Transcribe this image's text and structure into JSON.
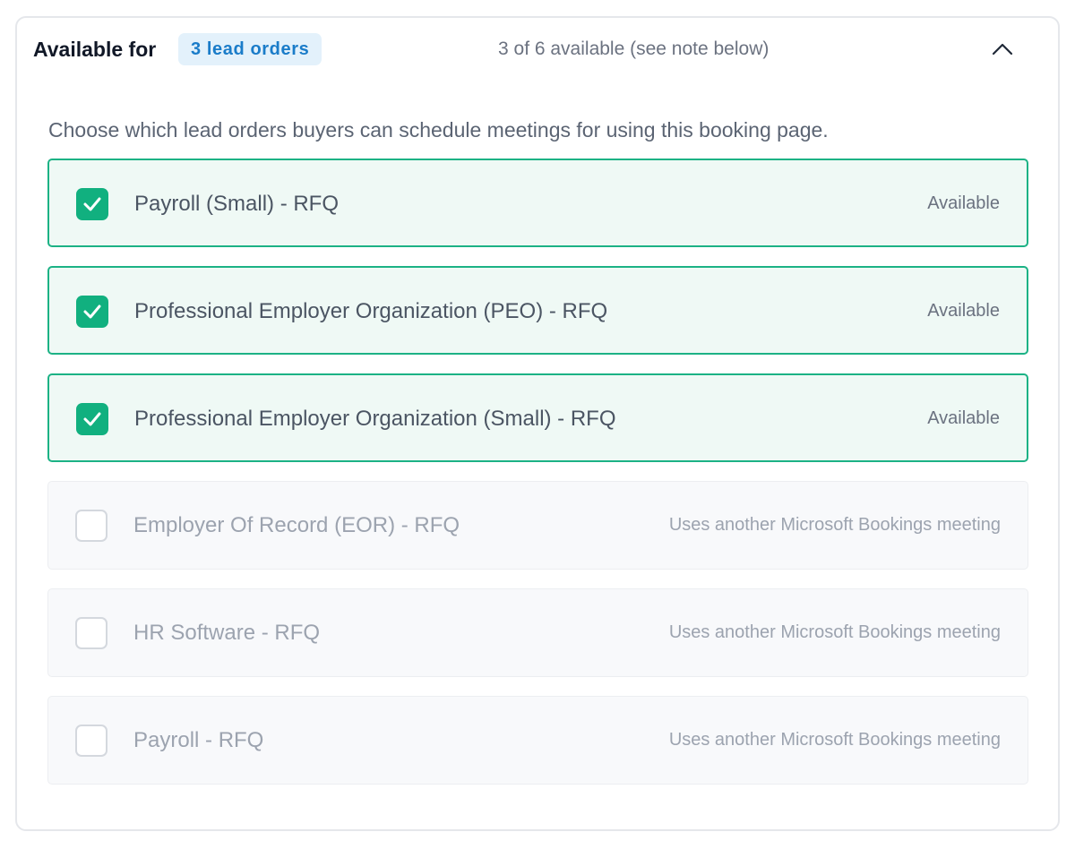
{
  "header": {
    "title": "Available for",
    "badge": "3 lead orders",
    "availability": "3 of 6 available (see note below)",
    "collapse_icon": "chevron-up-icon"
  },
  "description": "Choose which lead orders buyers can schedule meetings for using this booking page.",
  "lead_orders": [
    {
      "label": "Payroll (Small) - RFQ",
      "status": "Available",
      "checked": true,
      "enabled": true
    },
    {
      "label": "Professional Employer Organization (PEO) - RFQ",
      "status": "Available",
      "checked": true,
      "enabled": true
    },
    {
      "label": "Professional Employer Organization (Small) - RFQ",
      "status": "Available",
      "checked": true,
      "enabled": true
    },
    {
      "label": "Employer Of Record (EOR) - RFQ",
      "status": "Uses another Microsoft Bookings meeting",
      "checked": false,
      "enabled": false
    },
    {
      "label": "HR Software - RFQ",
      "status": "Uses another Microsoft Bookings meeting",
      "checked": false,
      "enabled": false
    },
    {
      "label": "Payroll - RFQ",
      "status": "Uses another Microsoft Bookings meeting",
      "checked": false,
      "enabled": false
    }
  ],
  "colors": {
    "accent_green": "#11b07f",
    "badge_blue": "#1a7cc9",
    "badge_bg": "#e3f1fb"
  }
}
